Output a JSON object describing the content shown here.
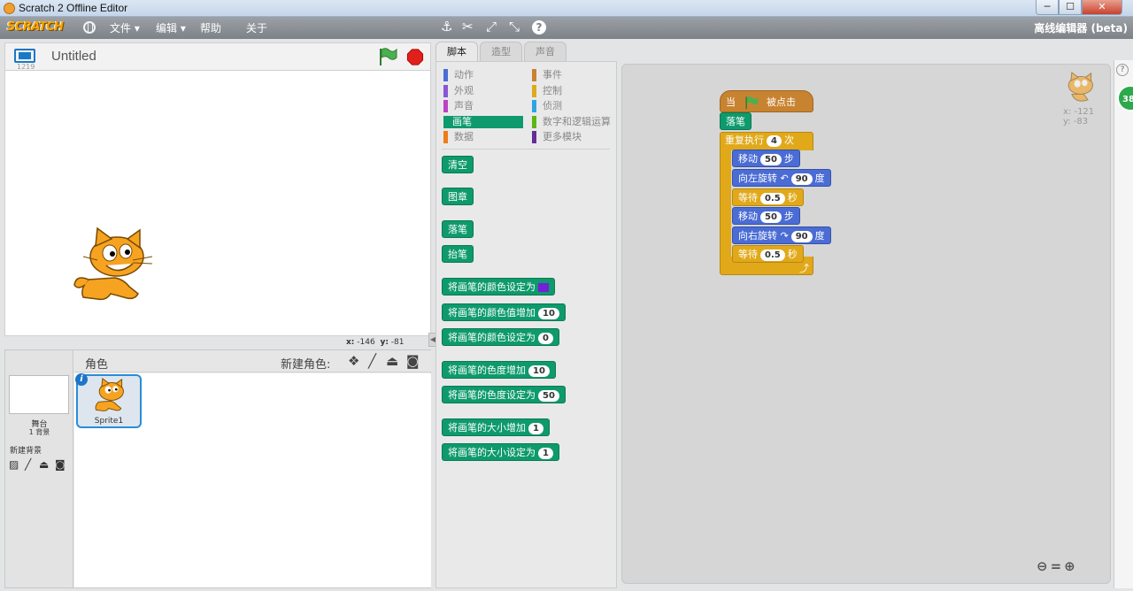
{
  "window": {
    "title": "Scratch 2 Offline Editor",
    "min": "─",
    "max": "☐",
    "close": "✕"
  },
  "menubar": {
    "logo": "SCRATCH",
    "items": [
      "文件 ▾",
      "编辑 ▾",
      "帮助",
      "关于"
    ],
    "tools": [
      "stamp-icon",
      "cut-icon",
      "grow-icon",
      "shrink-icon",
      "help-icon"
    ],
    "tool_glyphs": [
      "⚓",
      "✂",
      "⤢",
      "⤡",
      "?"
    ],
    "editor_title": "离线编辑器 (beta)"
  },
  "stage": {
    "version": "1219",
    "project_title": "Untitled",
    "mouse_x_label": "x:",
    "mouse_x": "-146",
    "mouse_y_label": "y:",
    "mouse_y": "-81"
  },
  "sprites": {
    "heading": "角色",
    "new_sprite_label": "新建角色:",
    "stage_name": "舞台",
    "backdrop_count": "1 背景",
    "new_backdrop_label": "新建背景",
    "sprite1": "Sprite1",
    "info": "i"
  },
  "tabs": [
    "脚本",
    "造型",
    "声音"
  ],
  "categories": [
    {
      "label": "动作",
      "color": "#4a6cd4"
    },
    {
      "label": "事件",
      "color": "#c88330"
    },
    {
      "label": "外观",
      "color": "#8a55d7"
    },
    {
      "label": "控制",
      "color": "#e1a91a"
    },
    {
      "label": "声音",
      "color": "#bb42c3"
    },
    {
      "label": "侦测",
      "color": "#2ca5e2"
    },
    {
      "label": "画笔",
      "color": "#0e9a6c"
    },
    {
      "label": "数字和逻辑运算",
      "color": "#5cb712"
    },
    {
      "label": "数据",
      "color": "#ee7d16"
    },
    {
      "label": "更多模块",
      "color": "#632d99"
    }
  ],
  "palette_blocks": [
    {
      "label": "清空"
    },
    {
      "label": "图章"
    },
    {
      "label": "落笔"
    },
    {
      "label": "抬笔"
    },
    {
      "label": "将画笔的颜色设定为",
      "color": "#7420d8"
    },
    {
      "label": "将画笔的颜色值增加",
      "value": "10"
    },
    {
      "label": "将画笔的颜色设定为",
      "value": "0"
    },
    {
      "label": "将画笔的色度增加",
      "value": "10"
    },
    {
      "label": "将画笔的色度设定为",
      "value": "50"
    },
    {
      "label": "将画笔的大小增加",
      "value": "1"
    },
    {
      "label": "将画笔的大小设定为",
      "value": "1"
    }
  ],
  "script": {
    "hat": {
      "pre": "当",
      "post": "被点击"
    },
    "pen_down": "落笔",
    "repeat": {
      "pre": "重复执行",
      "value": "4",
      "post": "次"
    },
    "body": [
      {
        "pre": "移动",
        "value": "50",
        "post": "步",
        "kind": "motion"
      },
      {
        "pre": "向左旋转",
        "arrow": "↶",
        "value": "90",
        "post": "度",
        "kind": "motion"
      },
      {
        "pre": "等待",
        "value": "0.5",
        "post": "秒",
        "kind": "control"
      },
      {
        "pre": "移动",
        "value": "50",
        "post": "步",
        "kind": "motion"
      },
      {
        "pre": "向右旋转",
        "arrow": "↷",
        "value": "90",
        "post": "度",
        "kind": "motion"
      },
      {
        "pre": "等待",
        "value": "0.5",
        "post": "秒",
        "kind": "control"
      }
    ],
    "loop_arrow": "⤴",
    "sprite_x": "x: -121",
    "sprite_y": "y: -83"
  },
  "zoom": {
    "out": "🔍−",
    "reset": "=",
    "in": "🔍+"
  },
  "badge": "38",
  "help": "?"
}
